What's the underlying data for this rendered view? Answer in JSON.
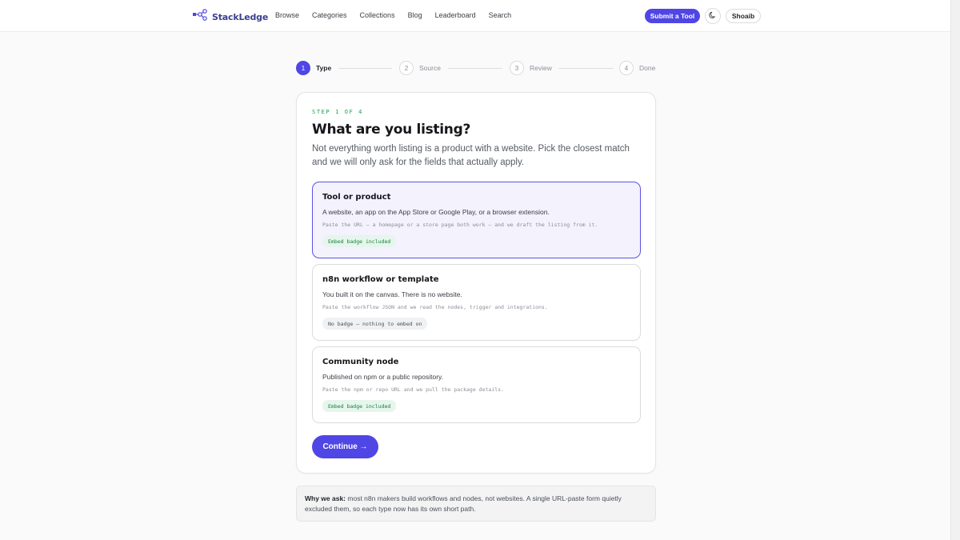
{
  "nav": {
    "logo_text": "StackLedge",
    "links": [
      "Browse",
      "Categories",
      "Collections",
      "Blog",
      "Leaderboard",
      "Search"
    ],
    "submit_label": "Submit a Tool",
    "theme_icon": "moon-icon",
    "user_label": "Shoaib"
  },
  "stepper": {
    "steps": [
      {
        "number": "1",
        "label": "Type",
        "active": true
      },
      {
        "number": "2",
        "label": "Source",
        "active": false
      },
      {
        "number": "3",
        "label": "Review",
        "active": false
      },
      {
        "number": "4",
        "label": "Done",
        "active": false
      }
    ]
  },
  "card": {
    "eyebrow": "STEP 1 OF 4",
    "heading": "What are you listing?",
    "intro": "Not everything worth listing is a product with a website. Pick the closest match and we will only ask for the fields that actually apply.",
    "options": [
      {
        "title": "Tool or product",
        "description": "A website, an app on the App Store or Google Play, or a browser extension.",
        "note": "Paste the URL — a homepage or a store page both work — and we draft the listing from it.",
        "badge": "Embed badge included",
        "selected": true
      },
      {
        "title": "n8n workflow or template",
        "description": "You built it on the canvas. There is no website.",
        "note": "Paste the workflow JSON and we read the nodes, trigger and integrations.",
        "badge": "No badge — nothing to embed on",
        "selected": false
      },
      {
        "title": "Community node",
        "description": "Published on npm or a public repository.",
        "note": "Paste the npm or repo URL and we pull the package details.",
        "badge": "Embed badge included",
        "selected": false
      }
    ],
    "continue_label": "Continue →"
  },
  "info": {
    "lead": "Why we ask:",
    "text": "most n8n makers build workflows and nodes, not websites. A single URL-paste form quietly excluded them, so each type now has its own short path."
  },
  "colors": {
    "accent": "#4f46e5",
    "selected_bg": "#f3f2fd",
    "badge_green_bg": "#e6f6ec",
    "badge_green_text": "#15803d",
    "eyebrow": "#16a34a"
  }
}
